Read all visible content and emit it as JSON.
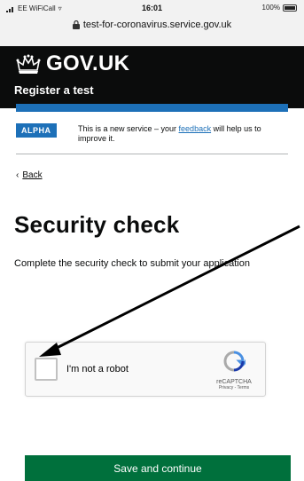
{
  "status_bar": {
    "carrier": "EE WiFiCall",
    "time": "16:01",
    "battery": "100%"
  },
  "url_bar": {
    "url": "test-for-coronavirus.service.gov.uk"
  },
  "header": {
    "brand": "GOV.UK",
    "service_name": "Register a test"
  },
  "phase_banner": {
    "tag": "ALPHA",
    "text_before": "This is a new service – your ",
    "link": "feedback",
    "text_after": " will help us to improve it."
  },
  "back_link": "Back",
  "page": {
    "title": "Security check",
    "description": "Complete the security check to submit your application"
  },
  "recaptcha": {
    "label": "I'm not a robot",
    "brand": "reCAPTCHA",
    "links": "Privacy - Terms"
  },
  "actions": {
    "submit_label": "Save and continue"
  },
  "colors": {
    "header_bg": "#0b0c0c",
    "brand_blue": "#1d70b8",
    "button_green": "#00703c"
  }
}
